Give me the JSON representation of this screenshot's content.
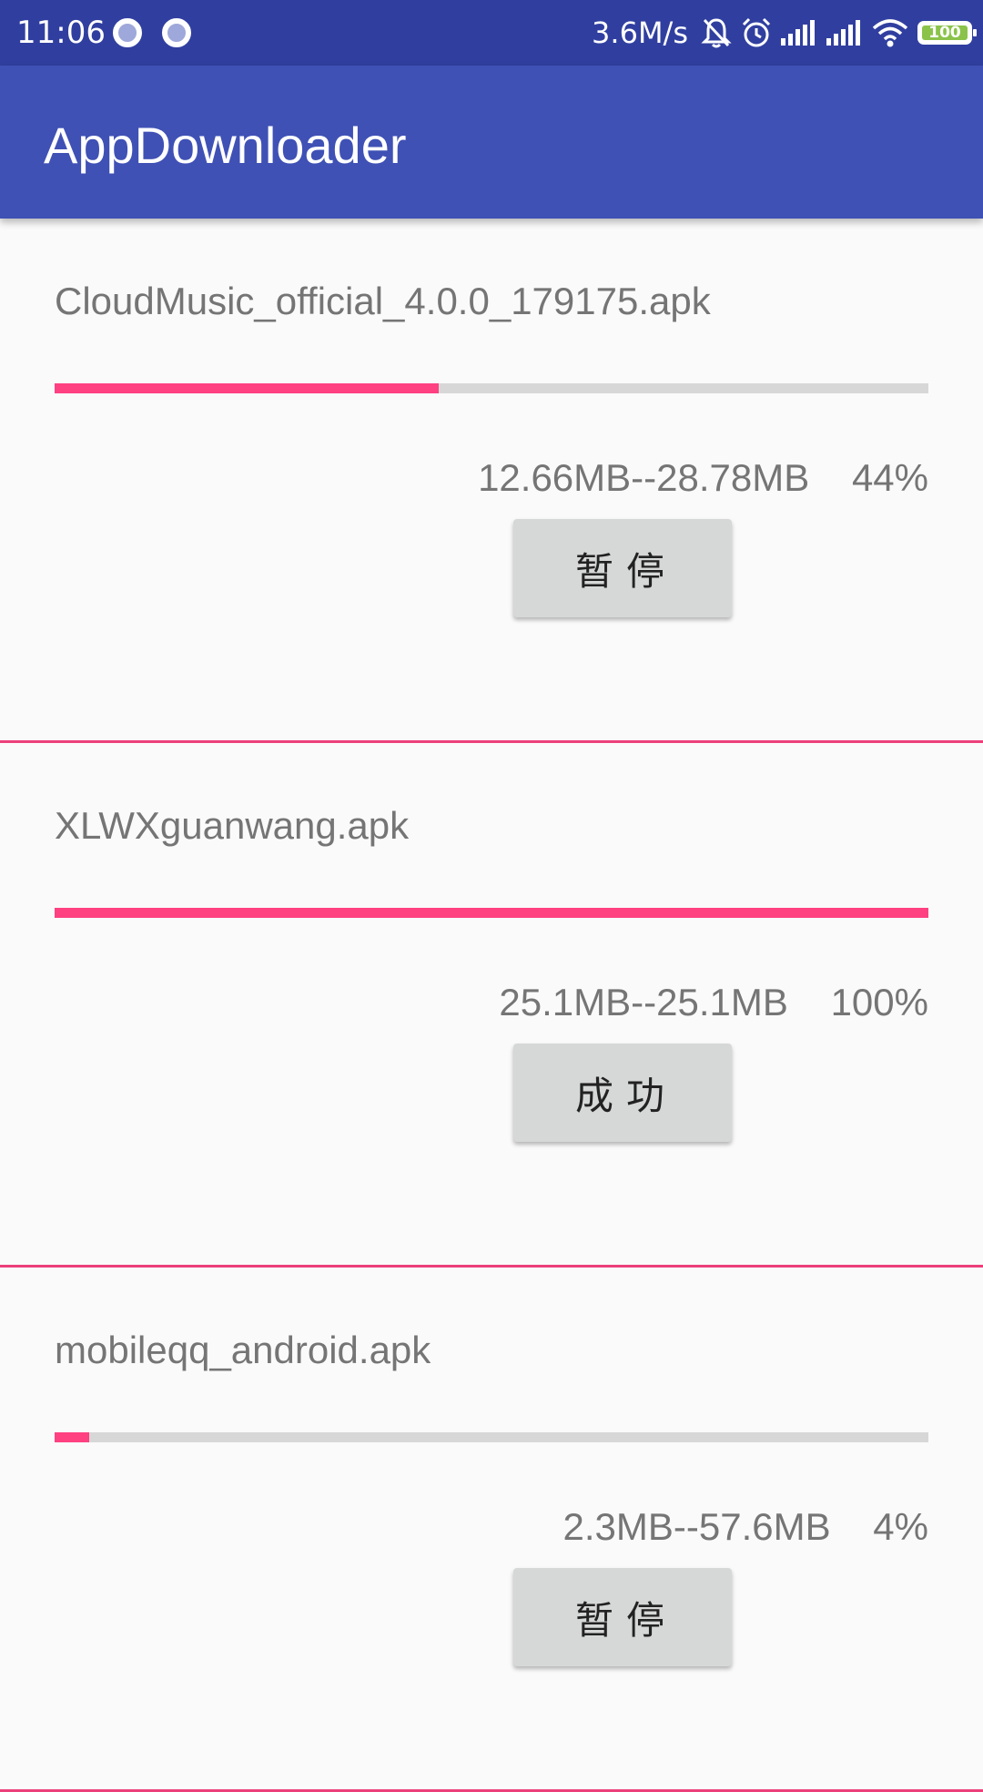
{
  "status_bar": {
    "time": "11:06",
    "net_speed": "3.6M/s",
    "battery": "100",
    "icons": [
      "notification-dot-icon",
      "notification-dot-icon",
      "mute-bell-icon",
      "alarm-icon",
      "signal-icon",
      "signal-icon",
      "wifi-icon",
      "battery-icon"
    ]
  },
  "app_bar": {
    "title": "AppDownloader",
    "color": "#3f51b5"
  },
  "accent_color": "#ff4081",
  "downloads": [
    {
      "name": "CloudMusic_official_4.0.0_179175.apk",
      "sizes": "12.66MB--28.78MB",
      "percent": "44%",
      "progress": 0.44,
      "button": "暂停"
    },
    {
      "name": "XLWXguanwang.apk",
      "sizes": "25.1MB--25.1MB",
      "percent": "100%",
      "progress": 1.0,
      "button": "成功"
    },
    {
      "name": "mobileqq_android.apk",
      "sizes": "2.3MB--57.6MB",
      "percent": "4%",
      "progress": 0.04,
      "button": "暂停"
    }
  ]
}
